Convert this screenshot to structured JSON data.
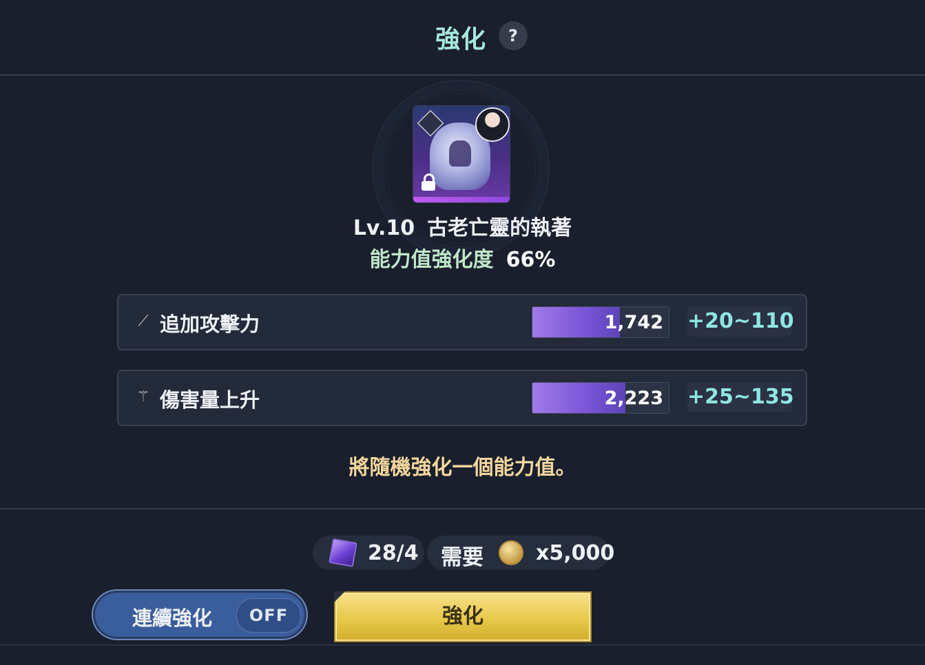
{
  "header": {
    "title": "強化",
    "help_label": "?"
  },
  "item": {
    "level": "Lv.10",
    "name": "古老亡靈的執著",
    "enhance_label": "能力值強化度",
    "enhance_value": "66%",
    "locked": true
  },
  "stats": [
    {
      "icon": "sword-icon",
      "label": "追加攻擊力",
      "value": "1,742",
      "fill_fraction": 0.64,
      "range": "+20~110"
    },
    {
      "icon": "damage-icon",
      "label": "傷害量上升",
      "value": "2,223",
      "fill_fraction": 0.68,
      "range": "+25~135"
    }
  ],
  "notice": "將隨機強化一個能力值。",
  "cost": {
    "material_count": "28/4",
    "required_label": "需要",
    "gold_amount": "x5,000"
  },
  "actions": {
    "auto_label": "連續強化",
    "auto_state": "OFF",
    "enhance_label": "強化"
  },
  "colors": {
    "background": "#1a1f2d",
    "title": "#a8e8dc",
    "range": "#8fe6e3",
    "notice": "#f2d79c",
    "bar_fill": "#7a55d6",
    "enhance_button": "#e8c94a",
    "toggle": "#3a5d9c"
  }
}
